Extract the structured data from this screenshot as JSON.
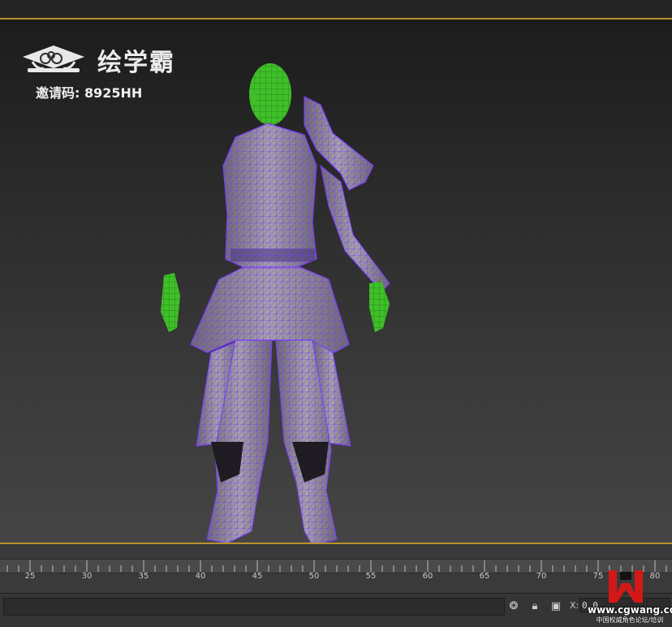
{
  "brand": {
    "name": "绘学霸",
    "invite_text": "邀请码: 8925HH"
  },
  "viewport": {
    "subject": "character wireframe model"
  },
  "timeline": {
    "labels": [
      "25",
      "30",
      "35",
      "40",
      "45",
      "50",
      "55",
      "60",
      "65",
      "70",
      "75",
      "80"
    ]
  },
  "statusbar": {
    "coord_label": "X:",
    "coord_value": "0.0"
  },
  "watermark": {
    "url": "www.cgwang.com",
    "subtitle": "中国权威角色论坛/培训"
  },
  "colors": {
    "accent_border": "#b8932e",
    "wire": "#7a3cff",
    "mesh": "#8f8a94",
    "selection_green": "#3fbf2a"
  }
}
